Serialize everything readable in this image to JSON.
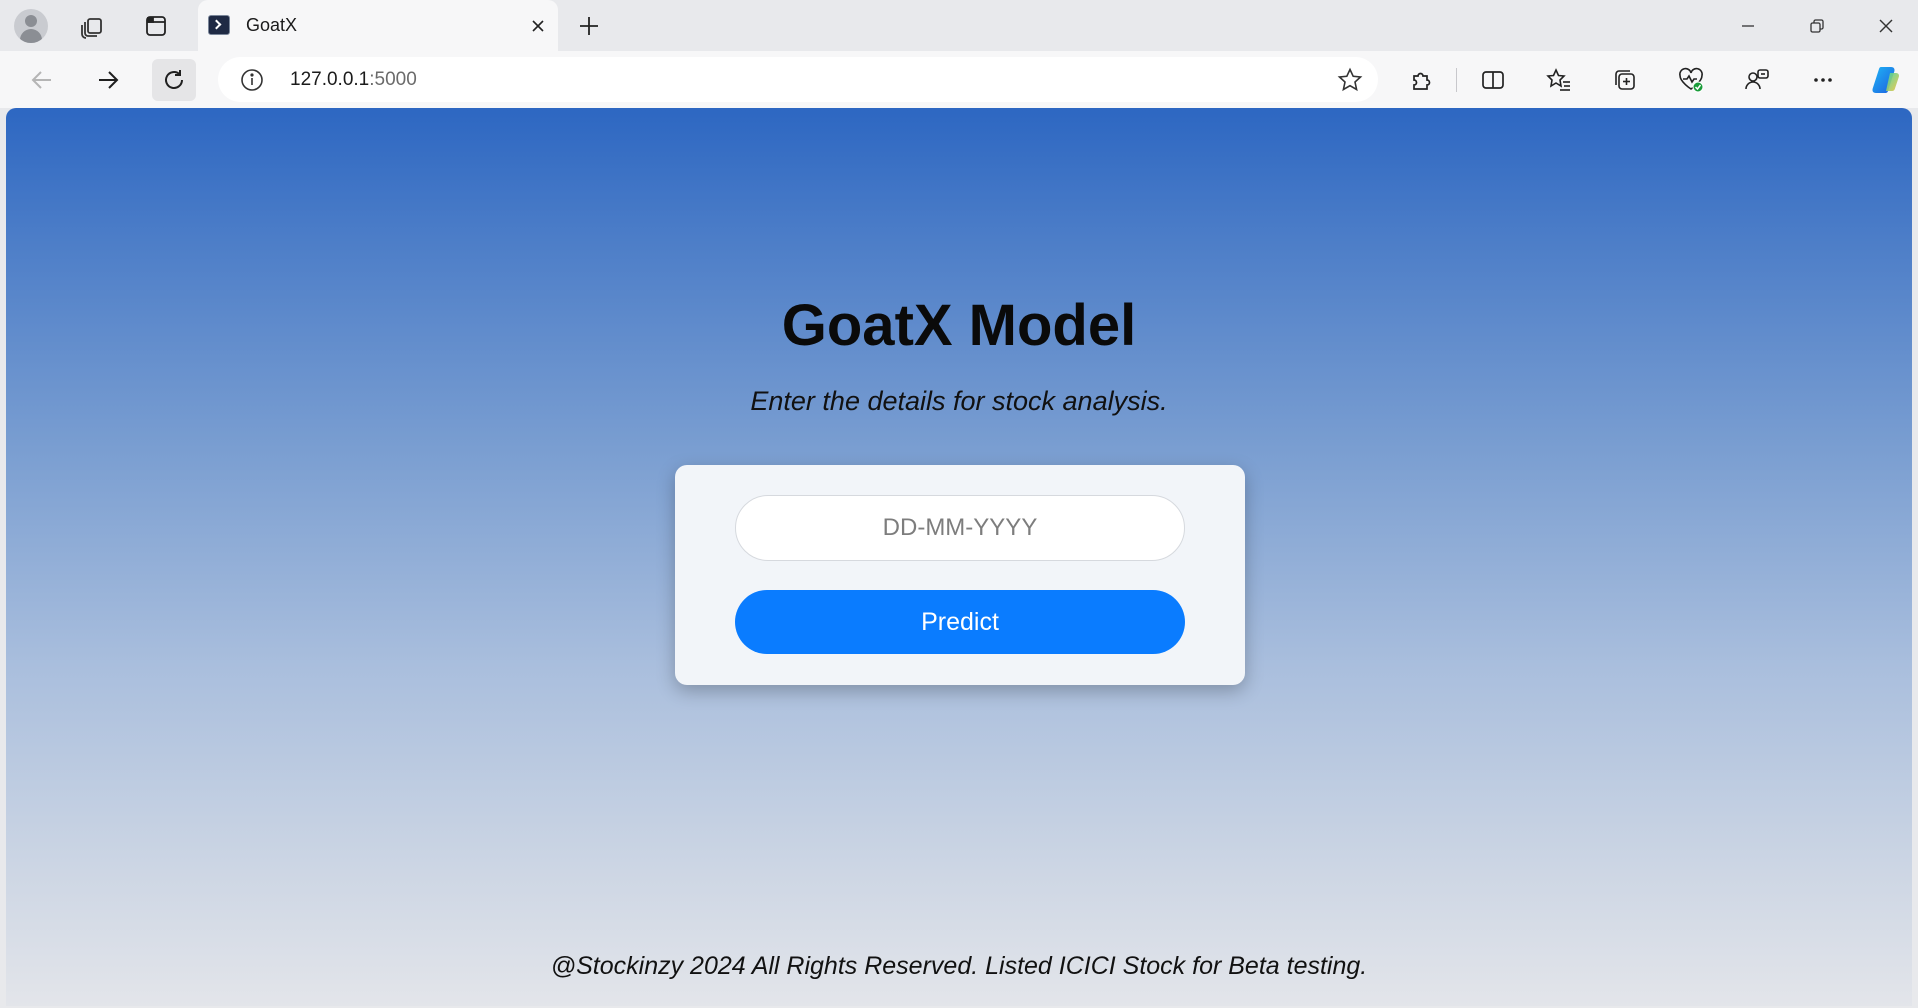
{
  "browser": {
    "tab": {
      "title": "GoatX",
      "favicon": "terminal-icon"
    },
    "address": {
      "host": "127.0.0.1",
      "port": ":5000"
    },
    "icons": {
      "profile": "profile-avatar-icon",
      "workspaces": "workspaces-icon",
      "tab_actions": "vertical-tabs-icon",
      "tab_close": "close-icon",
      "new_tab": "plus-icon",
      "minimize": "minimize-icon",
      "restore": "restore-icon",
      "close_window": "close-icon",
      "back": "arrow-left-icon",
      "forward": "arrow-right-icon",
      "refresh": "refresh-icon",
      "site_info": "info-icon",
      "favorite": "star-icon",
      "extensions": "puzzle-icon",
      "split_screen": "split-screen-icon",
      "favorites": "favorites-icon",
      "collections": "collections-icon",
      "browser_essentials": "heart-pulse-icon",
      "share": "share-icon",
      "more": "more-icon",
      "copilot": "copilot-icon"
    }
  },
  "page": {
    "heading": "GoatX Model",
    "subtitle": "Enter the details for stock analysis.",
    "form": {
      "date_placeholder": "DD-MM-YYYY",
      "date_value": "",
      "submit_label": "Predict"
    },
    "footer": "@Stockinzy 2024 All Rights Reserved. Listed ICICI Stock for Beta testing."
  },
  "colors": {
    "gradient_top": "#2d67c2",
    "gradient_bottom": "#e3e5ea",
    "button": "#0a7cff",
    "card": "#f2f5f9"
  }
}
